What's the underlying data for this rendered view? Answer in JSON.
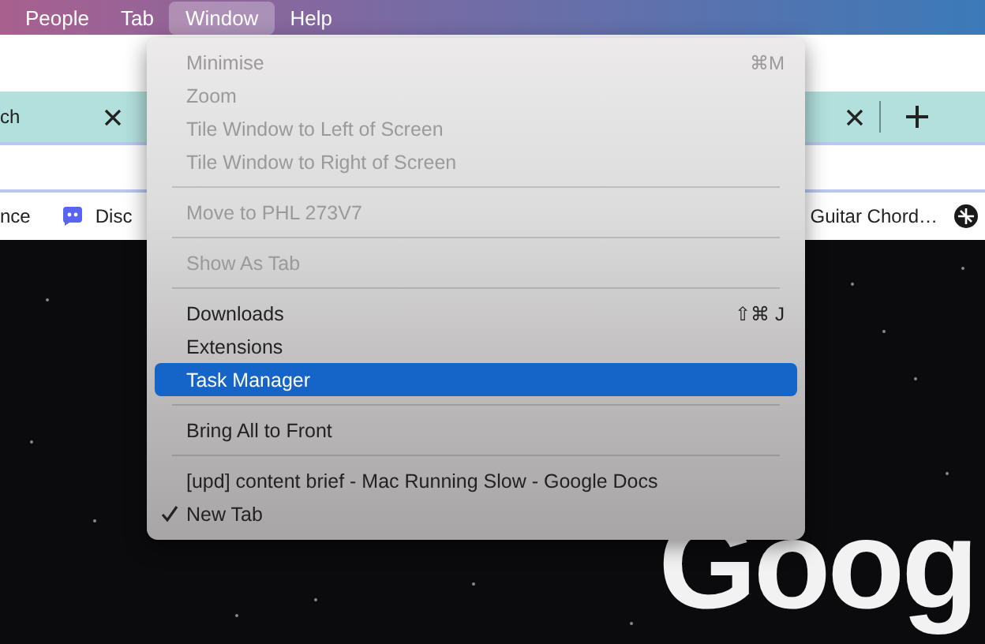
{
  "menubar": {
    "items": [
      {
        "label": "People",
        "selected": false
      },
      {
        "label": "Tab",
        "selected": false
      },
      {
        "label": "Window",
        "selected": true
      },
      {
        "label": "Help",
        "selected": false
      }
    ]
  },
  "tab_strip": {
    "tabs": [
      {
        "title": "ch",
        "closable": true
      },
      {
        "closable": true
      }
    ]
  },
  "bookmarks": [
    {
      "label": "nce",
      "kind": "text"
    },
    {
      "label": "Disc",
      "kind": "chat"
    },
    {
      "label": "Guitar Chord…",
      "kind": "text"
    },
    {
      "kind": "globe"
    }
  ],
  "page": {
    "logo_text": "Goog"
  },
  "window_menu": {
    "sections": [
      [
        {
          "label": "Minimise",
          "shortcut": "⌘M",
          "disabled": true,
          "selected": false,
          "checked": false
        },
        {
          "label": "Zoom",
          "disabled": true,
          "selected": false,
          "checked": false
        },
        {
          "label": "Tile Window to Left of Screen",
          "disabled": true,
          "selected": false,
          "checked": false
        },
        {
          "label": "Tile Window to Right of Screen",
          "disabled": true,
          "selected": false,
          "checked": false
        }
      ],
      [
        {
          "label": "Move to PHL 273V7",
          "disabled": true,
          "selected": false,
          "checked": false
        }
      ],
      [
        {
          "label": "Show As Tab",
          "disabled": true,
          "selected": false,
          "checked": false
        }
      ],
      [
        {
          "label": "Downloads",
          "shortcut": "⇧⌘ J",
          "disabled": false,
          "selected": false,
          "checked": false
        },
        {
          "label": "Extensions",
          "disabled": false,
          "selected": false,
          "checked": false
        },
        {
          "label": "Task Manager",
          "disabled": false,
          "selected": true,
          "checked": false
        }
      ],
      [
        {
          "label": "Bring All to Front",
          "disabled": false,
          "selected": false,
          "checked": false
        }
      ],
      [
        {
          "label": "[upd] content brief - Mac Running Slow - Google Docs",
          "disabled": false,
          "selected": false,
          "checked": false
        },
        {
          "label": "New Tab",
          "disabled": false,
          "selected": false,
          "checked": true
        }
      ]
    ]
  }
}
